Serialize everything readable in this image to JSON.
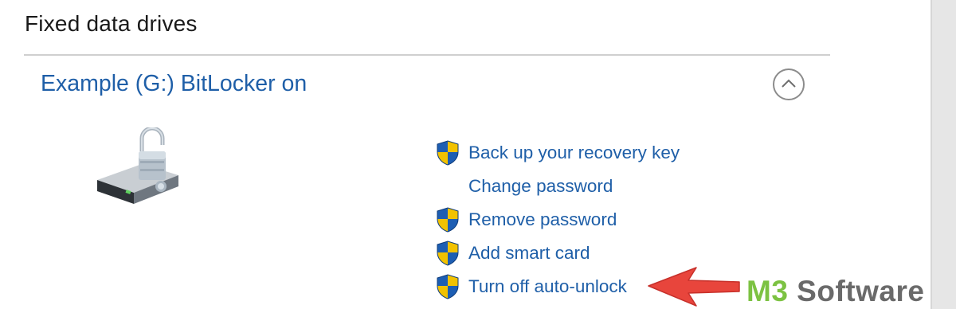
{
  "section": {
    "heading": "Fixed data drives"
  },
  "drive": {
    "title": "Example (G:) BitLocker on",
    "icon": "drive-unlocked-icon"
  },
  "actions": [
    {
      "label": "Back up your recovery key",
      "icon": "uac-shield-icon"
    },
    {
      "label": "Change password",
      "icon": ""
    },
    {
      "label": "Remove password",
      "icon": "uac-shield-icon"
    },
    {
      "label": "Add smart card",
      "icon": "uac-shield-icon"
    },
    {
      "label": "Turn off auto-unlock",
      "icon": "uac-shield-icon"
    }
  ],
  "watermark": {
    "brand_prefix": "M3",
    "brand_suffix": " Software"
  },
  "colors": {
    "link": "#1f5fa8",
    "divider": "#cfcfcf",
    "arrow": "#e8453c",
    "brand_green": "#7cc242",
    "brand_gray": "#6a6a6a",
    "shield_blue": "#1d5eb3",
    "shield_yellow": "#f2c200"
  }
}
